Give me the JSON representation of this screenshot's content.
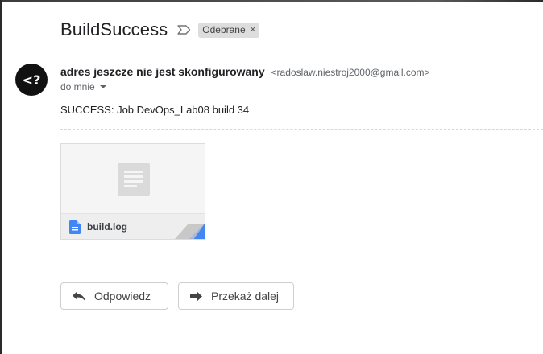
{
  "email": {
    "subject": "BuildSuccess",
    "label": "Odebrane",
    "label_remove": "×",
    "avatar_text": "<?",
    "sender_name": "adres jeszcze nie jest skonfigurowany",
    "sender_email": "<radoslaw.niestroj2000@gmail.com>",
    "recipient": "do mnie",
    "body": "SUCCESS: Job DevOps_Lab08 build 34"
  },
  "attachment": {
    "file_name": "build.log"
  },
  "actions": {
    "reply_label": "Odpowiedz",
    "forward_label": "Przekaż dalej"
  },
  "colors": {
    "file_icon": "#4285f4",
    "avatar_bg": "#111111",
    "label_bg": "#dddddd"
  }
}
